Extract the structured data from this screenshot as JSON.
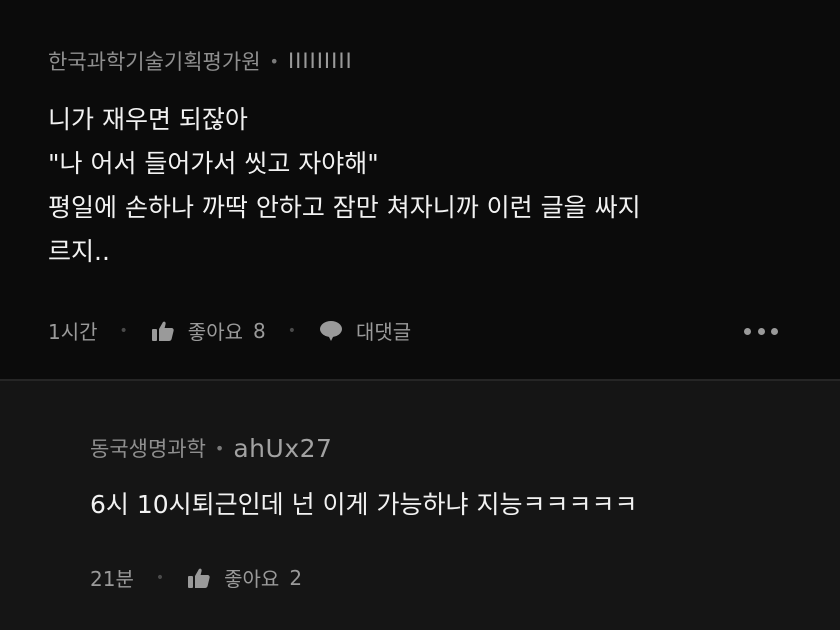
{
  "comments": [
    {
      "author": "한국과학기술기획평가원",
      "handle": "IIIIIIIII",
      "lines": [
        "니가 재우면 되잖아",
        "\"나 어서 들어가서 씻고 자야해\"",
        "평일에 손하나 까딱 안하고 잠만 쳐자니까 이런 글을 싸지",
        "르지.."
      ],
      "time": "1시간",
      "like_label": "좋아요",
      "like_count": "8",
      "reply_label": "대댓글",
      "like_icon": "thumbs-up-icon",
      "reply_icon": "speech-bubble-icon",
      "more_icon": "more-horizontal-icon"
    }
  ],
  "reply": {
    "author": "동국생명과학",
    "handle": "ahUx27",
    "text": "6시 10시퇴근인데 넌 이게 가능하냐 지능ㅋㅋㅋㅋㅋ",
    "time": "21분",
    "like_label": "좋아요",
    "like_count": "2",
    "like_icon": "thumbs-up-icon"
  },
  "colors": {
    "background": "#0b0b0b",
    "reply_background": "#151515",
    "text": "#f2f2f2",
    "muted": "#8f8f8f"
  }
}
